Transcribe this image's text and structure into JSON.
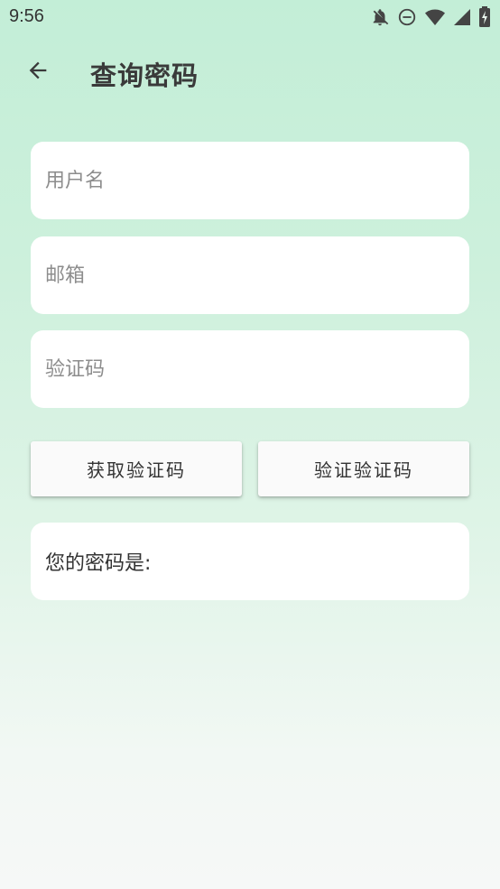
{
  "status_bar": {
    "time": "9:56",
    "icons": [
      "bell-off-icon",
      "do-not-disturb-icon",
      "wifi-icon",
      "signal-icon",
      "battery-charging-icon"
    ]
  },
  "app_bar": {
    "back_icon": "arrow-left-icon",
    "title": "查询密码"
  },
  "form": {
    "username": {
      "value": "",
      "placeholder": "用户名"
    },
    "email": {
      "value": "",
      "placeholder": "邮箱"
    },
    "code": {
      "value": "",
      "placeholder": "验证码"
    }
  },
  "buttons": {
    "get_code": "获取验证码",
    "verify_code": "验证验证码"
  },
  "result": {
    "label": "您的密码是:",
    "value": ""
  }
}
